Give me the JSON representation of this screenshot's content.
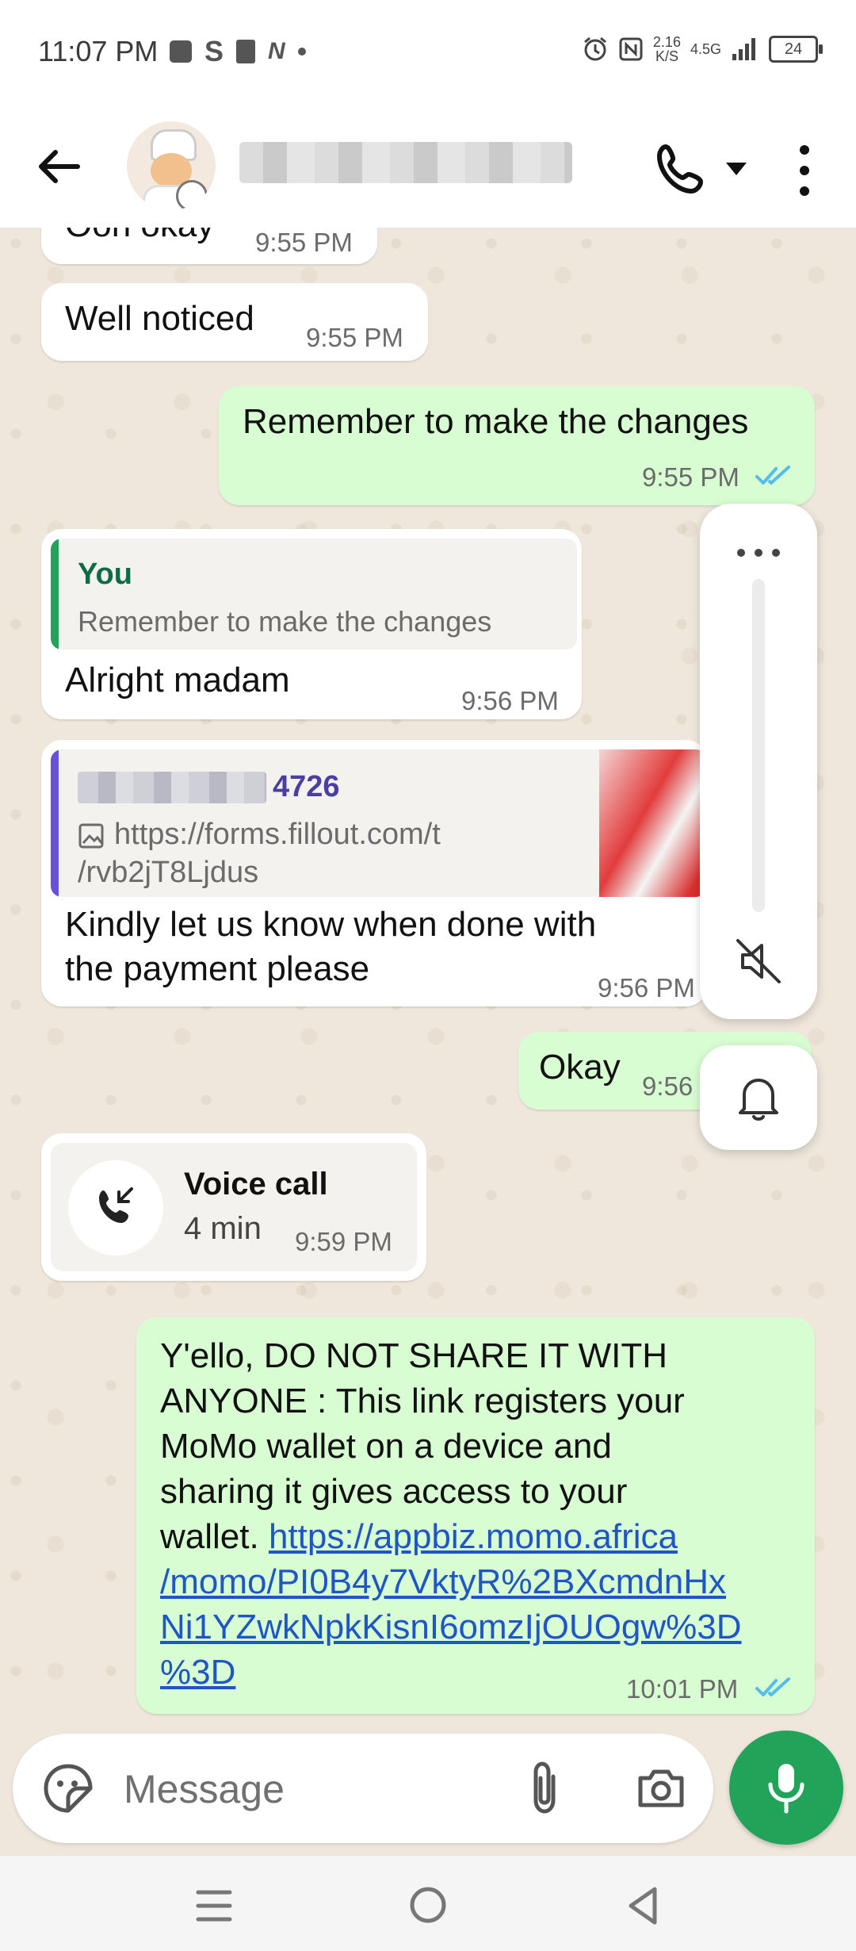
{
  "status": {
    "time": "11:07 PM",
    "net_speed_value": "2.16",
    "net_speed_unit": "K/S",
    "network": "4.5G",
    "battery": "24"
  },
  "header": {
    "back_icon": "arrow-left-icon",
    "call_icon": "phone-icon",
    "more_icon": "more-vertical-icon"
  },
  "messages": [
    {
      "text": "Oon okay",
      "time": "9:55 PM"
    },
    {
      "text": "Well noticed",
      "time": "9:55 PM"
    },
    {
      "text": "Remember to make the changes",
      "time": "9:55 PM"
    },
    {
      "quote_author": "You",
      "quote_text": "Remember to make the changes",
      "text": "Alright madam",
      "time": "9:56 PM"
    },
    {
      "quote_author_suffix": "4726",
      "quote_link_line1": "https://forms.fillout.com/t",
      "quote_link_line2": "/rvb2jT8Ljdus",
      "text_line1": "Kindly let us know when done with",
      "text_line2": "the payment please",
      "time": "9:56 PM"
    },
    {
      "text": "Okay",
      "time": "9:56"
    },
    {
      "call_title": "Voice call",
      "call_duration": "4 min",
      "time": "9:59 PM"
    },
    {
      "text_lines": [
        "Y'ello, DO NOT SHARE IT WITH",
        "ANYONE : This link registers your",
        "MoMo wallet on a device and",
        "sharing it gives access to your"
      ],
      "text_prefix": "wallet. ",
      "link_lines": [
        "https://appbiz.momo.africa",
        "/momo/PI0B4y7VktyR%2BXcmdnHx",
        "Ni1YZwkNpkKisnI6omzIjOUOgw%3D",
        "%3D"
      ],
      "time": "10:01 PM"
    }
  ],
  "input": {
    "placeholder": "Message"
  },
  "colors": {
    "accent_green": "#21a35a",
    "outgoing_bubble": "#d9fdd3",
    "read_ticks": "#53bdeb",
    "quote_bar_you": "#21a35a",
    "quote_bar_other": "#6a4fd8",
    "link": "#1f56c7"
  }
}
